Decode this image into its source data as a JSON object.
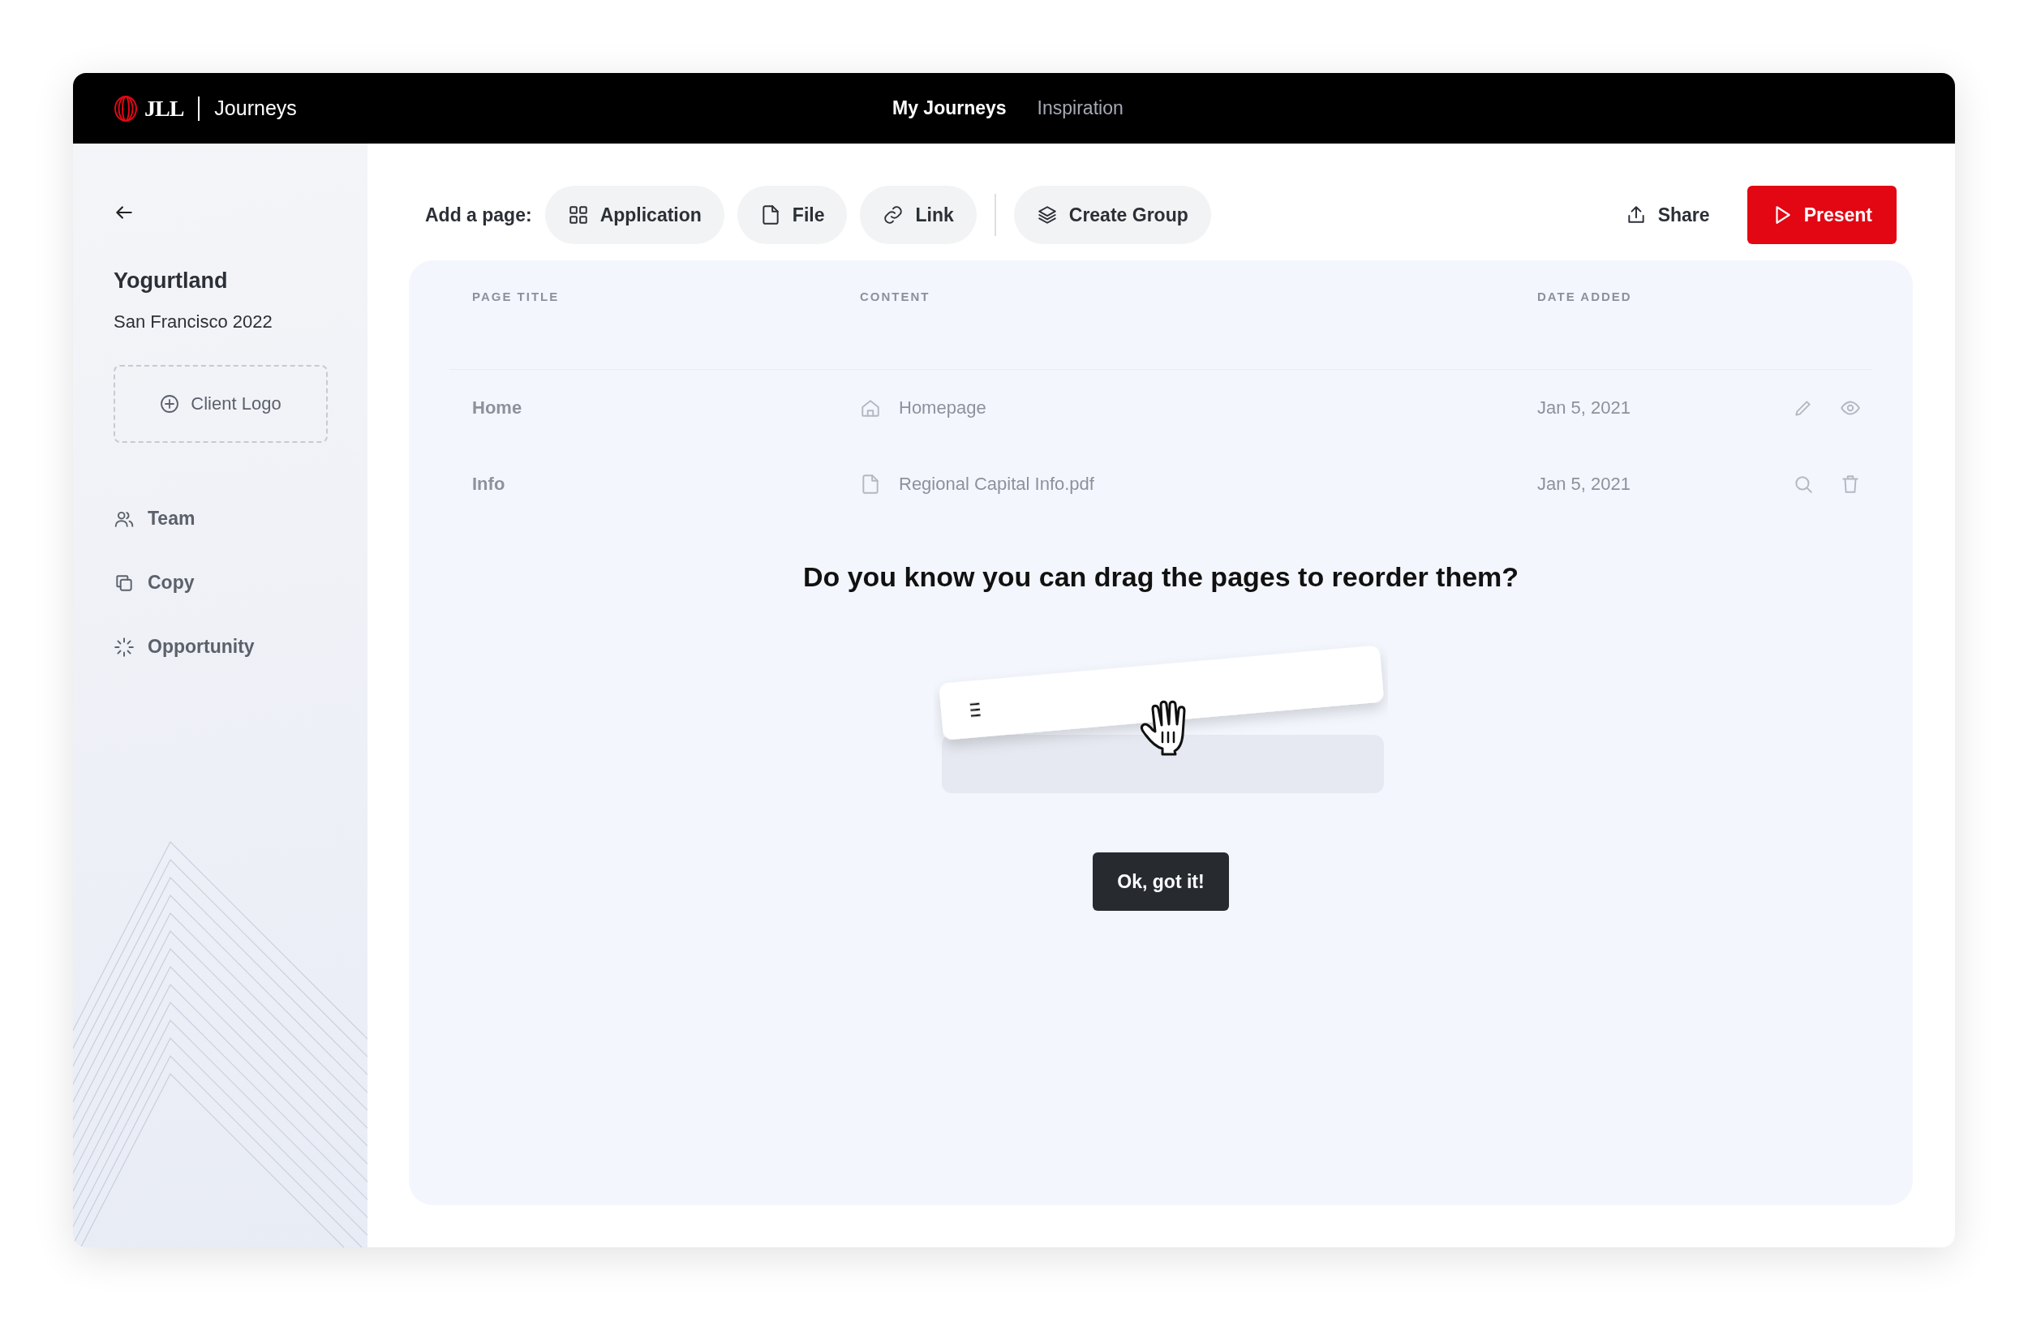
{
  "header": {
    "brand": "JLL",
    "product": "Journeys",
    "nav": [
      {
        "label": "My Journeys",
        "selected": true
      },
      {
        "label": "Inspiration",
        "selected": false
      }
    ]
  },
  "sidebar": {
    "client": "Yogurtland",
    "subtitle": "San Francisco 2022",
    "logo_button": "Client Logo",
    "items": [
      {
        "label": "Team",
        "kind": "team"
      },
      {
        "label": "Copy",
        "kind": "copy"
      },
      {
        "label": "Opportunity",
        "kind": "opportunity"
      }
    ]
  },
  "toolbar": {
    "label": "Add a page:",
    "buttons": [
      {
        "label": "Application",
        "kind": "application"
      },
      {
        "label": "File",
        "kind": "file"
      },
      {
        "label": "Link",
        "kind": "link"
      },
      {
        "label": "Create Group",
        "kind": "group"
      }
    ],
    "share": "Share",
    "present": "Present"
  },
  "table": {
    "columns": [
      "PAGE TITLE",
      "CONTENT",
      "DATE ADDED"
    ],
    "rows": [
      {
        "title": "Home",
        "content": "Homepage",
        "date": "Jan 5, 2021"
      },
      {
        "title": "Info",
        "content": "Regional Capital Info.pdf",
        "date": "Jan 5, 2021"
      }
    ]
  },
  "tip": {
    "text": "Do you know you can drag the pages to reorder them?",
    "button": "Ok, got it!"
  }
}
